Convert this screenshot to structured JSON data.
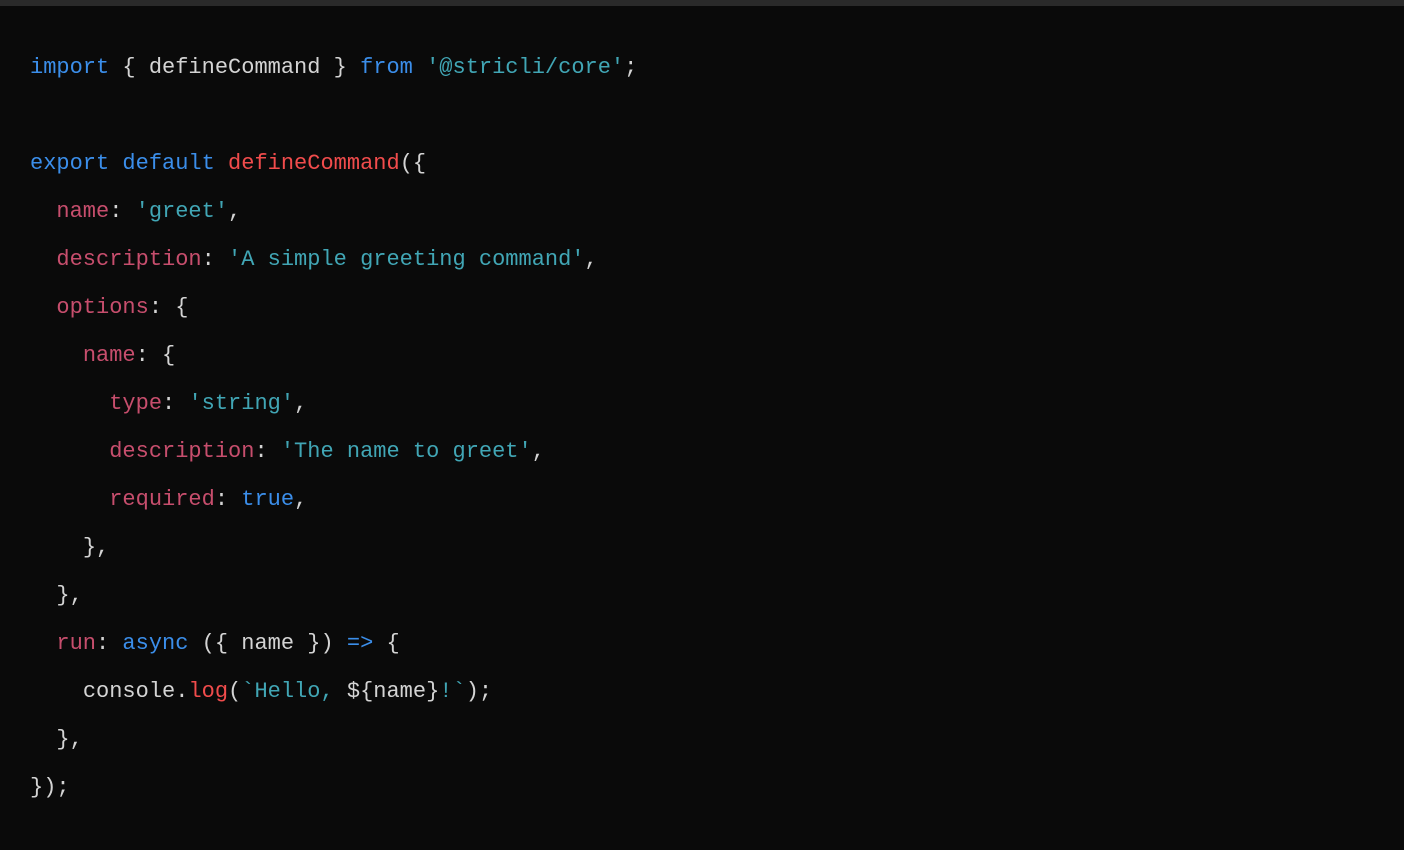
{
  "code": {
    "l1_import": "import",
    "l1_brace_open": " { ",
    "l1_symbol": "defineCommand",
    "l1_brace_close": " } ",
    "l1_from": "from",
    "l1_space": " ",
    "l1_pkg": "'@stricli/core'",
    "l1_semi": ";",
    "l3_export": "export",
    "l3_default": " default ",
    "l3_fn": "defineCommand",
    "l3_open": "({",
    "l4_indent": "  ",
    "l4_prop": "name",
    "l4_colon": ": ",
    "l4_val": "'greet'",
    "l4_comma": ",",
    "l5_indent": "  ",
    "l5_prop": "description",
    "l5_colon": ": ",
    "l5_val": "'A simple greeting command'",
    "l5_comma": ",",
    "l6_indent": "  ",
    "l6_prop": "options",
    "l6_colon": ": {",
    "l7_indent": "    ",
    "l7_prop": "name",
    "l7_colon": ": {",
    "l8_indent": "      ",
    "l8_prop": "type",
    "l8_colon": ": ",
    "l8_val": "'string'",
    "l8_comma": ",",
    "l9_indent": "      ",
    "l9_prop": "description",
    "l9_colon": ": ",
    "l9_val": "'The name to greet'",
    "l9_comma": ",",
    "l10_indent": "      ",
    "l10_prop": "required",
    "l10_colon": ": ",
    "l10_val": "true",
    "l10_comma": ",",
    "l11_indent": "    ",
    "l11_close": "},",
    "l12_indent": "  ",
    "l12_close": "},",
    "l13_indent": "  ",
    "l13_prop": "run",
    "l13_colon": ": ",
    "l13_async": "async",
    "l13_params": " ({ name }) ",
    "l13_arrow": "=>",
    "l13_brace": " {",
    "l14_indent": "    ",
    "l14_obj": "console",
    "l14_dot": ".",
    "l14_method": "log",
    "l14_open": "(",
    "l14_tick1": "`",
    "l14_tmpl1": "Hello, ",
    "l14_interp_open": "${",
    "l14_var": "name",
    "l14_interp_close": "}",
    "l14_tmpl2": "!",
    "l14_tick2": "`",
    "l14_close": ");",
    "l15_indent": "  ",
    "l15_close": "},",
    "l16_close": "});"
  }
}
